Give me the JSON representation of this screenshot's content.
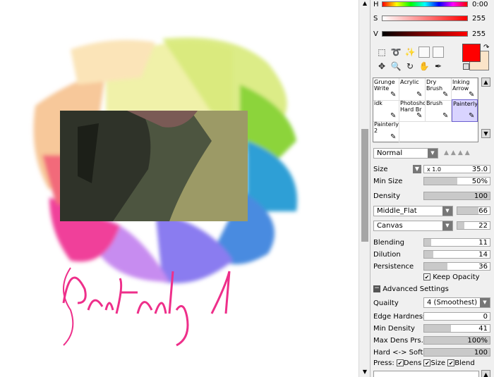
{
  "canvas": {
    "artwork_text": "Painterly 1"
  },
  "color": {
    "h_label": "H",
    "h_value": "0:00",
    "s_label": "S",
    "s_value": "255",
    "v_label": "V",
    "v_value": "255",
    "primary": "#ff0000",
    "secondary": "#fbe4c8"
  },
  "tools": {
    "icons": [
      "rect-select-icon",
      "lasso-icon",
      "magic-wand-icon",
      "move-icon",
      "zoom-icon",
      "rotate-icon",
      "hand-icon",
      "eyedropper-icon"
    ]
  },
  "brushes": [
    {
      "label": "Grunge Write",
      "selected": false
    },
    {
      "label": "Acrylic",
      "selected": false
    },
    {
      "label": "Dry Brush",
      "selected": false
    },
    {
      "label": "Inking Arrow",
      "selected": false
    },
    {
      "label": "idk",
      "selected": false
    },
    {
      "label": "Photoshop Hard Br",
      "selected": false
    },
    {
      "label": "Brush",
      "selected": false
    },
    {
      "label": "Painterly",
      "selected": true
    },
    {
      "label": "Painterly 2",
      "selected": false
    }
  ],
  "blend_mode": "Normal",
  "size": {
    "label": "Size",
    "multiplier": "x 1.0",
    "value": "35.0"
  },
  "min_size": {
    "label": "Min Size",
    "value": "50%",
    "fraction": 0.5
  },
  "density": {
    "label": "Density",
    "value": "100",
    "fraction": 1.0
  },
  "shape": {
    "name": "Middle_Flat",
    "value": "66",
    "fraction": 0.66
  },
  "texture": {
    "name": "Canvas",
    "value": "22",
    "fraction": 0.22
  },
  "blending": {
    "label": "Blending",
    "value": "11",
    "fraction": 0.11
  },
  "dilution": {
    "label": "Dilution",
    "value": "14",
    "fraction": 0.14
  },
  "persistence": {
    "label": "Persistence",
    "value": "36",
    "fraction": 0.36
  },
  "keep_opacity": {
    "label": "Keep Opacity",
    "checked": true
  },
  "advanced": {
    "label": "Advanced Settings"
  },
  "quality": {
    "label": "Quailty",
    "value": "4 (Smoothest)"
  },
  "edge_hardness": {
    "label": "Edge Hardness",
    "value": "0",
    "fraction": 0.0
  },
  "min_density": {
    "label": "Min Density",
    "value": "41",
    "fraction": 0.41
  },
  "max_dens_prs": {
    "label": "Max Dens Prs.",
    "value": "100%",
    "fraction": 1.0
  },
  "hard_soft": {
    "label": "Hard <-> Soft",
    "value": "100",
    "fraction": 1.0
  },
  "press": {
    "label": "Press:",
    "dens": "Dens",
    "size": "Size",
    "blend": "Blend"
  }
}
